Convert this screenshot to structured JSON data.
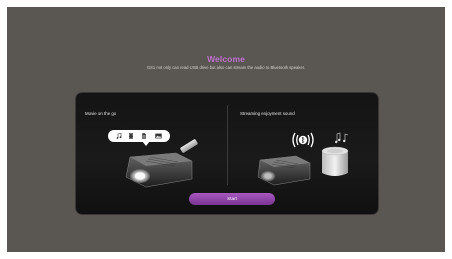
{
  "header": {
    "title": "Welcome",
    "subtitle": "GS1 not only can read USB drive but also can stream the audio to Bluetooth speaker."
  },
  "features": [
    {
      "title": "Movie on the go",
      "icons": [
        "music-note-icon",
        "video-file-icon",
        "document-icon",
        "photo-icon"
      ]
    },
    {
      "title": "Streaming enjoyment sound",
      "icons": [
        "bluetooth-sound-waves-icon",
        "music-notes-icon"
      ]
    }
  ],
  "start_button": {
    "label": "Start"
  },
  "colors": {
    "background": "#5a5652",
    "panel": "#161616",
    "accent": "#b060c8",
    "title": "#c070d0"
  }
}
